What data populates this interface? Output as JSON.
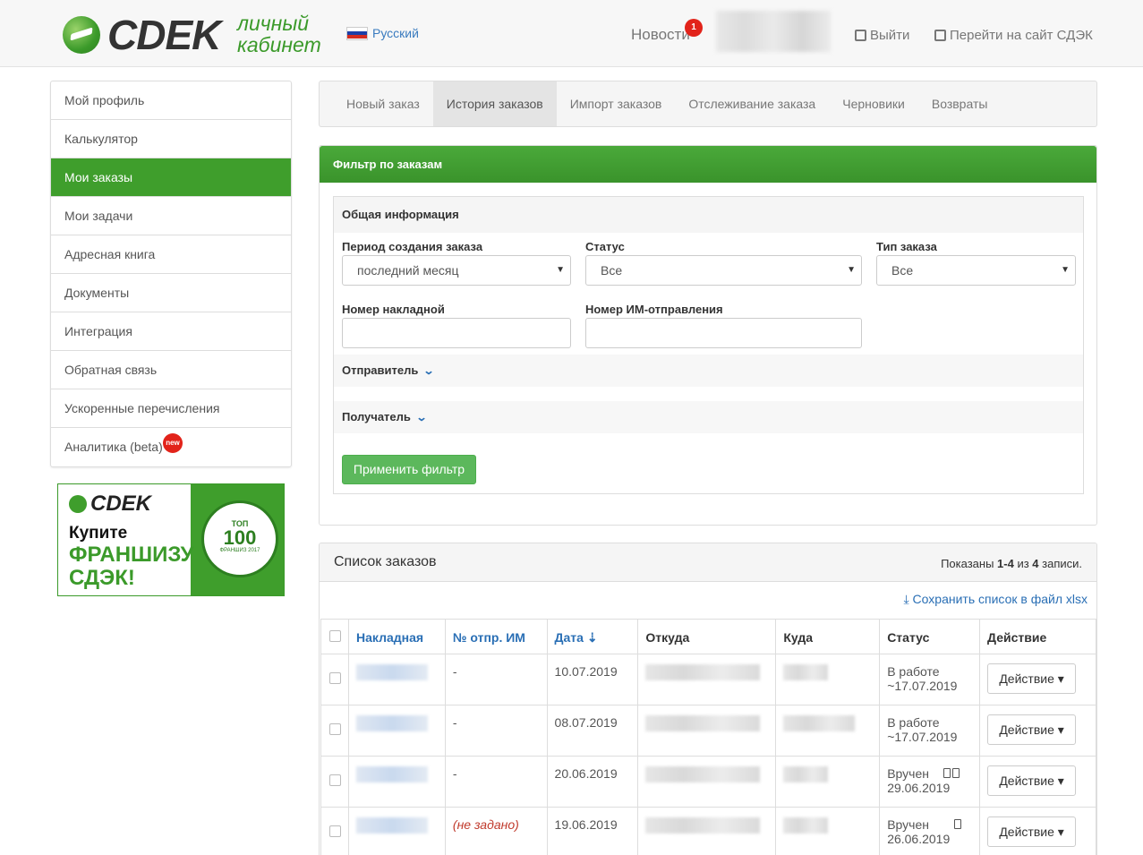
{
  "header": {
    "brand": "CDEK",
    "brand_sub_line1": "личный",
    "brand_sub_line2": "кабинет",
    "language": "Русский",
    "news_label": "Новости",
    "news_count": "1",
    "logout_label": "Выйти",
    "go_site_label": "Перейти на сайт СДЭК"
  },
  "sidebar": {
    "items": [
      {
        "label": "Мой профиль"
      },
      {
        "label": "Калькулятор"
      },
      {
        "label": "Мои заказы"
      },
      {
        "label": "Мои задачи"
      },
      {
        "label": "Адресная книга"
      },
      {
        "label": "Документы"
      },
      {
        "label": "Интеграция"
      },
      {
        "label": "Обратная связь"
      },
      {
        "label": "Ускоренные перечисления"
      },
      {
        "label": "Аналитика (beta)"
      }
    ],
    "active_index": 2,
    "new_badge": "new"
  },
  "banner": {
    "logo": "CDEK",
    "line1": "Купите",
    "line2": "ФРАНШИЗУ",
    "line3": "СДЭК!",
    "seal_top": "ТОП",
    "seal_num": "100",
    "seal_bottom": "ФРАНШИЗ 2017"
  },
  "tabs": [
    {
      "label": "Новый заказ"
    },
    {
      "label": "История заказов"
    },
    {
      "label": "Импорт заказов"
    },
    {
      "label": "Отслеживание заказа"
    },
    {
      "label": "Черновики"
    },
    {
      "label": "Возвраты"
    }
  ],
  "active_tab": 1,
  "filter": {
    "title": "Фильтр по заказам",
    "section_title": "Общая информация",
    "period_label": "Период создания заказа",
    "period_value": "последний месяц",
    "status_label": "Статус",
    "status_value": "Все",
    "type_label": "Тип заказа",
    "type_value": "Все",
    "waybill_label": "Номер накладной",
    "waybill_value": "",
    "im_label": "Номер ИМ-отправления",
    "im_value": "",
    "sender_label": "Отправитель",
    "receiver_label": "Получатель",
    "apply_label": "Применить фильтр"
  },
  "orders": {
    "title": "Список заказов",
    "shown_prefix": "Показаны ",
    "shown_range": "1-4",
    "shown_mid": " из ",
    "shown_total": "4",
    "shown_suffix": " записи.",
    "save_label": "Сохранить список в файл xlsx",
    "columns": [
      "Накладная",
      "№ отпр. ИМ",
      "Дата",
      "Откуда",
      "Куда",
      "Статус",
      "Действие"
    ],
    "rows": [
      {
        "im": "-",
        "date": "10.07.2019",
        "status": "В работе",
        "status_date": "~17.07.2019",
        "docs": 0,
        "action": "Действие"
      },
      {
        "im": "-",
        "date": "08.07.2019",
        "status": "В работе",
        "status_date": "~17.07.2019",
        "docs": 0,
        "action": "Действие"
      },
      {
        "im": "-",
        "date": "20.06.2019",
        "status": "Вручен",
        "status_date": "29.06.2019",
        "docs": 2,
        "action": "Действие"
      },
      {
        "im": "(не задано)",
        "date": "19.06.2019",
        "status": "Вручен",
        "status_date": "26.06.2019",
        "docs": 1,
        "action": "Действие"
      }
    ]
  }
}
